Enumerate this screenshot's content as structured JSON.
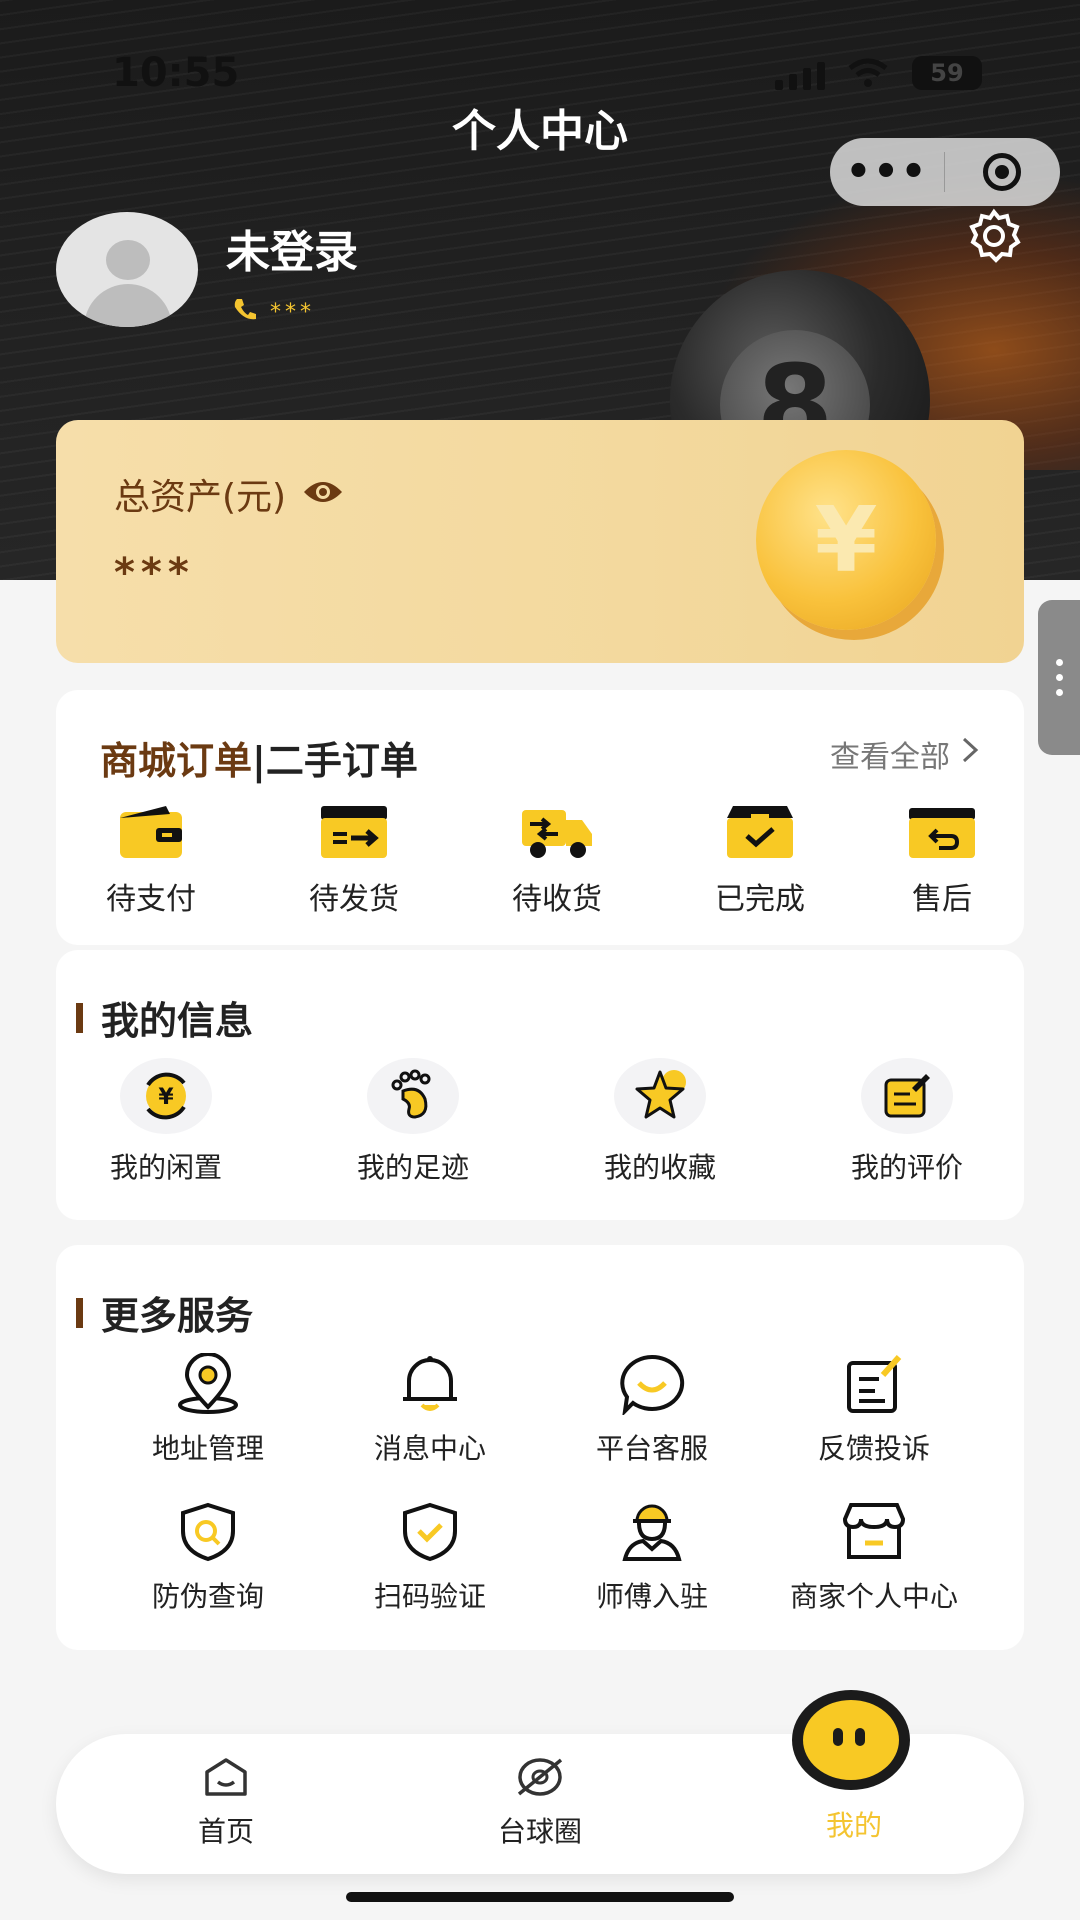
{
  "status_bar": {
    "time": "10:55",
    "battery": "59"
  },
  "header": {
    "title": "个人中心"
  },
  "profile": {
    "name": "未登录",
    "phone": "***"
  },
  "assets": {
    "label": "总资产(元)",
    "value": "***"
  },
  "orders": {
    "tab_active": "商城订单",
    "divider": "|",
    "tab_other": "二手订单",
    "view_all": "查看全部",
    "items": [
      {
        "label": "待支付",
        "icon": "wallet-icon"
      },
      {
        "label": "待发货",
        "icon": "ship-box-icon"
      },
      {
        "label": "待收货",
        "icon": "truck-icon"
      },
      {
        "label": "已完成",
        "icon": "done-box-icon"
      },
      {
        "label": "售后",
        "icon": "return-box-icon"
      }
    ]
  },
  "my_info": {
    "title": "我的信息",
    "items": [
      {
        "label": "我的闲置",
        "icon": "idle-yuan-icon"
      },
      {
        "label": "我的足迹",
        "icon": "footprint-icon"
      },
      {
        "label": "我的收藏",
        "icon": "star-icon"
      },
      {
        "label": "我的评价",
        "icon": "review-icon"
      }
    ]
  },
  "services": {
    "title": "更多服务",
    "items": [
      {
        "label": "地址管理",
        "icon": "location-icon"
      },
      {
        "label": "消息中心",
        "icon": "bell-icon"
      },
      {
        "label": "平台客服",
        "icon": "chat-icon"
      },
      {
        "label": "反馈投诉",
        "icon": "feedback-icon"
      },
      {
        "label": "防伪查询",
        "icon": "shield-search-icon"
      },
      {
        "label": "扫码验证",
        "icon": "shield-check-icon"
      },
      {
        "label": "师傅入驻",
        "icon": "worker-icon"
      },
      {
        "label": "商家个人中心",
        "icon": "store-icon"
      }
    ]
  },
  "tabbar": {
    "items": [
      {
        "label": "首页",
        "icon": "home-icon"
      },
      {
        "label": "台球圈",
        "icon": "billiard-circle-icon"
      },
      {
        "label": "我的",
        "icon": "mascot-icon"
      }
    ],
    "active_color": "#f4c430"
  },
  "colors": {
    "accent": "#f4c430",
    "brown": "#6b3a12"
  }
}
